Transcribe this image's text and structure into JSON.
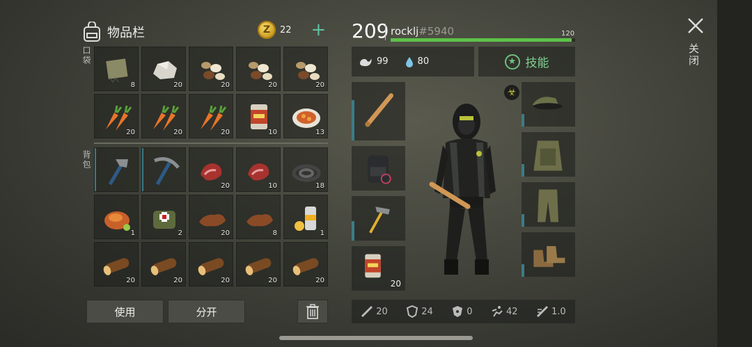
{
  "header": {
    "title": "物品栏",
    "coins": "22",
    "add_label": "+"
  },
  "sections": {
    "pockets": "口袋",
    "backpack": "背包"
  },
  "pockets": [
    {
      "name": "bandage-icon",
      "count": "8"
    },
    {
      "name": "stone-icon",
      "count": "20"
    },
    {
      "name": "seeds-icon",
      "count": "20"
    },
    {
      "name": "seeds-icon",
      "count": "20"
    },
    {
      "name": "seeds-icon",
      "count": "20"
    },
    {
      "name": "carrot-icon",
      "count": "20"
    },
    {
      "name": "carrot-icon",
      "count": "20"
    },
    {
      "name": "carrot-icon",
      "count": "20"
    },
    {
      "name": "canned-food-icon",
      "count": "10"
    },
    {
      "name": "stew-plate-icon",
      "count": "13"
    }
  ],
  "backpack": [
    {
      "name": "hatchet-icon",
      "count": ""
    },
    {
      "name": "pickaxe-icon",
      "count": ""
    },
    {
      "name": "raw-meat-icon",
      "count": "20"
    },
    {
      "name": "raw-meat-icon",
      "count": "10"
    },
    {
      "name": "rope-coil-icon",
      "count": "18"
    },
    {
      "name": "roast-chicken-icon",
      "count": "1"
    },
    {
      "name": "medkit-bag-icon",
      "count": "2"
    },
    {
      "name": "leather-icon",
      "count": "20"
    },
    {
      "name": "leather-icon",
      "count": "8"
    },
    {
      "name": "spray-can-icon",
      "count": "1"
    },
    {
      "name": "log-icon",
      "count": "20"
    },
    {
      "name": "log-icon",
      "count": "20"
    },
    {
      "name": "log-icon",
      "count": "20"
    },
    {
      "name": "log-icon",
      "count": "20"
    },
    {
      "name": "log-icon",
      "count": "20"
    }
  ],
  "buttons": {
    "use": "使用",
    "split": "分开"
  },
  "player": {
    "level": "209",
    "name": "rocklj",
    "tag": "#5940",
    "xp_max": "120",
    "xp_fraction": 0.98
  },
  "needs": {
    "hunger": "99",
    "thirst": "80"
  },
  "skills_label": "技能",
  "left_equip": [
    {
      "name": "baseball-bat-icon",
      "count": ""
    },
    {
      "name": "backpack-icon",
      "count": ""
    },
    {
      "name": "hammer-icon",
      "count": ""
    },
    {
      "name": "canned-food-icon",
      "count": "20"
    }
  ],
  "right_equip": [
    "military-cap-icon",
    "camo-vest-icon",
    "camo-pants-icon",
    "boots-icon"
  ],
  "stats": [
    {
      "icon": "attack-icon",
      "value": "20"
    },
    {
      "icon": "armor-icon",
      "value": "24"
    },
    {
      "icon": "radiation-resist-icon",
      "value": "0"
    },
    {
      "icon": "speed-icon",
      "value": "42"
    },
    {
      "icon": "attack-speed-icon",
      "value": "1.0"
    }
  ],
  "close_label": "关闭",
  "colors": {
    "xp": "#5cc24a",
    "accent": "#3d7b86",
    "skill": "#7fd090"
  }
}
